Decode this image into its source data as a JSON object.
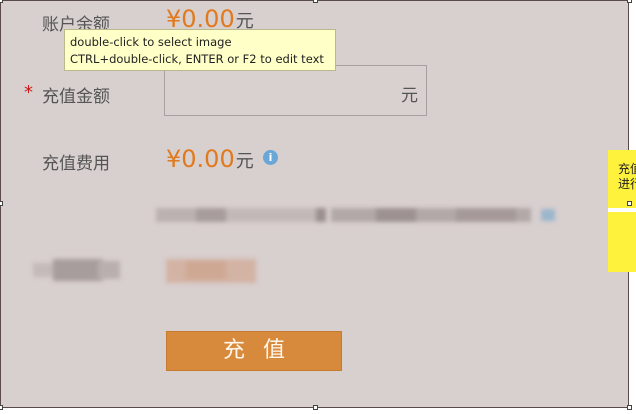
{
  "form": {
    "balance_label": "账户余额",
    "balance_value": "¥0.00",
    "balance_unit": "元",
    "amount_required_mark": "*",
    "amount_label": "充值金额",
    "amount_input_value": "",
    "amount_unit": "元",
    "fee_label": "充值费用",
    "fee_value": "¥0.00",
    "fee_unit": "元",
    "info_icon_glyph": "i",
    "submit_label": "充值"
  },
  "tooltip": {
    "line1": "double-click to select image",
    "line2": "CTRL+double-click, ENTER or F2 to edit text"
  },
  "side_note": {
    "line1": "充值",
    "line2": "进行"
  },
  "colors": {
    "accent": "#e07a1c",
    "button": "#d88a3c",
    "required": "#d01818",
    "panel": "#d8cfcf",
    "tooltip": "#ffffc8",
    "note": "#fff23c"
  }
}
